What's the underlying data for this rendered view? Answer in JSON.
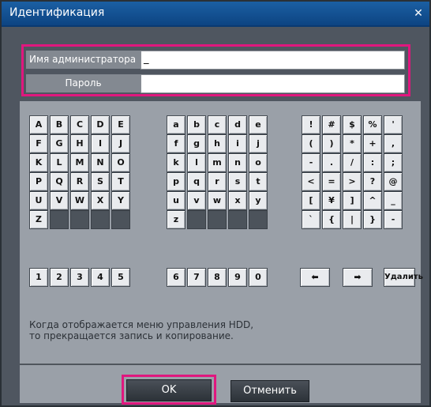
{
  "window": {
    "title": "Идентификация",
    "close_glyph": "✕"
  },
  "credentials": {
    "admin_label": "Имя администратора",
    "admin_value": "_",
    "password_label": "Пароль",
    "password_value": ""
  },
  "keyboard": {
    "upper_rows": [
      [
        "A",
        "B",
        "C",
        "D",
        "E"
      ],
      [
        "F",
        "G",
        "H",
        "I",
        "J"
      ],
      [
        "K",
        "L",
        "M",
        "N",
        "O"
      ],
      [
        "P",
        "Q",
        "R",
        "S",
        "T"
      ],
      [
        "U",
        "V",
        "W",
        "X",
        "Y"
      ],
      [
        "Z",
        "",
        "",
        "",
        ""
      ]
    ],
    "lower_rows": [
      [
        "a",
        "b",
        "c",
        "d",
        "e"
      ],
      [
        "f",
        "g",
        "h",
        "i",
        "j"
      ],
      [
        "k",
        "l",
        "m",
        "n",
        "o"
      ],
      [
        "p",
        "q",
        "r",
        "s",
        "t"
      ],
      [
        "u",
        "v",
        "w",
        "x",
        "y"
      ],
      [
        "z",
        "",
        "",
        "",
        ""
      ]
    ],
    "symbol_rows": [
      [
        "!",
        "#",
        "$",
        "%",
        "'"
      ],
      [
        "(",
        ")",
        "*",
        "+",
        ","
      ],
      [
        "-",
        ".",
        "/",
        ":",
        ";"
      ],
      [
        "<",
        "=",
        ">",
        "?",
        "@"
      ],
      [
        "[",
        "¥",
        "]",
        "^",
        "_"
      ],
      [
        "`",
        "{",
        "|",
        "}",
        "-"
      ]
    ],
    "digits_left": [
      "1",
      "2",
      "3",
      "4",
      "5"
    ],
    "digits_right": [
      "6",
      "7",
      "8",
      "9",
      "0"
    ],
    "nav": {
      "left_arrow": "⬅",
      "right_arrow": "➡",
      "delete_label": "Удалить"
    }
  },
  "message": {
    "line1": "Когда отображается меню управления HDD,",
    "line2": "то прекращается запись и копирование."
  },
  "buttons": {
    "ok": "OK",
    "cancel": "Отменить"
  },
  "colors": {
    "title_bar": "#0d4482",
    "highlight": "#e0177e",
    "dialog_bg": "#4f5660",
    "panel_bg": "#9aa0a8"
  }
}
